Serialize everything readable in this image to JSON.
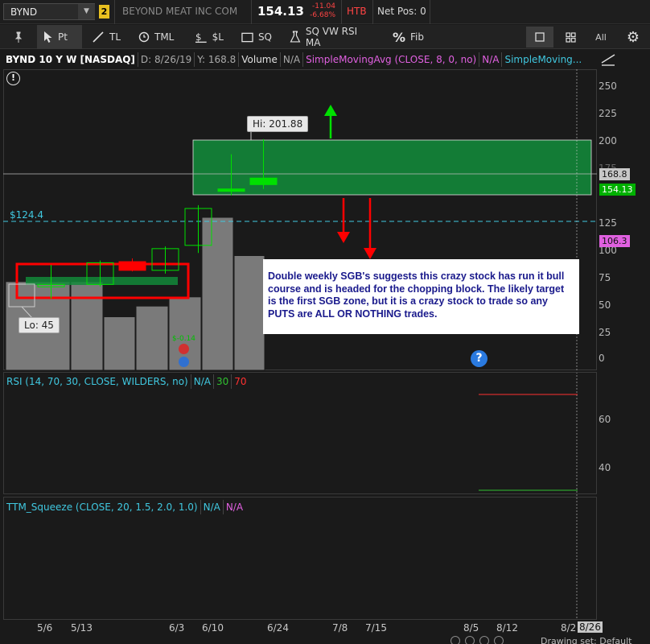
{
  "topbar": {
    "symbol": "BYND",
    "link_group": "2",
    "company": "BEYOND MEAT INC COM",
    "last": "154.13",
    "net_change": "-11.04",
    "pct_change": "-6.68%",
    "htb": "HTB",
    "net_pos": "Net Pos: 0"
  },
  "toolbar": {
    "pointer_label": "Pt",
    "trendline_label": "TL",
    "timeline_label": "TML",
    "pricelevel_label": "$L",
    "square_label": "SQ",
    "study_label": "SQ VW RSI MA",
    "fib_label": "Fib",
    "all_label": "All"
  },
  "chart_header": {
    "title": "BYND 10 Y W [NASDAQ]",
    "date": "D: 8/26/19",
    "y_value": "Y: 168.8",
    "volume_label": "Volume",
    "volume_value": "N/A",
    "sma_label": "SimpleMovingAvg (CLOSE, 8, 0, no)",
    "sma_value": "N/A",
    "sma2_label": "SimpleMoving..."
  },
  "price_axis": [
    "250",
    "225",
    "200",
    "175",
    "125",
    "100",
    "75",
    "50",
    "25",
    "0"
  ],
  "price_tags": {
    "crosshair": "168.8",
    "last": "154.13",
    "sma": "106.3"
  },
  "level_label": "$124.4",
  "callouts": {
    "high": "Hi: 201.88",
    "low": "Lo: 45"
  },
  "event_marker": "$-0.14",
  "annotation": "Double weekly SGB's suggests this crazy stock has run it bull course and is headed for the chopping block. The likely target is the first SGB zone, but it is a crazy stock to trade so any PUTS are ALL OR NOTHING trades.",
  "help_glyph": "?",
  "alert_glyph": "!",
  "rsi": {
    "label": "RSI (14, 70, 30, CLOSE, WILDERS, no)",
    "value": "N/A",
    "ob": "70",
    "os": "30",
    "axis": [
      "60",
      "40"
    ]
  },
  "squeeze": {
    "label": "TTM_Squeeze (CLOSE, 20, 1.5, 2.0, 1.0)",
    "v1": "N/A",
    "v2": "N/A"
  },
  "dates": [
    "5/6",
    "5/13",
    "6/3",
    "6/10",
    "6/24",
    "7/8",
    "7/15",
    "8/5",
    "8/12",
    "8/2",
    "8/26"
  ],
  "footer_partial": "Drawing set: Default",
  "colors": {
    "up": "#00e000",
    "down": "#ff0000",
    "zone": "#138a3a",
    "study_magenta": "#e060e0",
    "study_cyan": "#40c8e0"
  },
  "chart_data": {
    "type": "candlestick",
    "ylim": [
      0,
      260
    ],
    "candles": [
      {
        "date": "5/6",
        "open": 66,
        "high": 86,
        "low": 55,
        "close": 68
      },
      {
        "date": "5/13",
        "open": 68,
        "high": 90,
        "low": 66,
        "close": 88
      },
      {
        "date": "5/20",
        "open": 89,
        "high": 92,
        "low": 80,
        "close": 81
      },
      {
        "date": "5/27",
        "open": 81,
        "high": 103,
        "low": 78,
        "close": 101
      },
      {
        "date": "6/3",
        "open": 104,
        "high": 141,
        "low": 97,
        "close": 138
      },
      {
        "date": "6/10",
        "open": 154,
        "high": 188,
        "low": 150,
        "close": 156
      },
      {
        "date": "6/17",
        "open": 160,
        "high": 201.88,
        "low": 156,
        "close": 166
      }
    ],
    "volume": [
      {
        "date": "5/6",
        "value": 0.58
      },
      {
        "date": "5/13",
        "value": 0.58
      },
      {
        "date": "5/20",
        "value": 0.35
      },
      {
        "date": "5/27",
        "value": 0.42
      },
      {
        "date": "6/3",
        "value": 0.48
      },
      {
        "date": "6/10",
        "value": 1.0
      },
      {
        "date": "6/17",
        "value": 0.75
      }
    ]
  }
}
